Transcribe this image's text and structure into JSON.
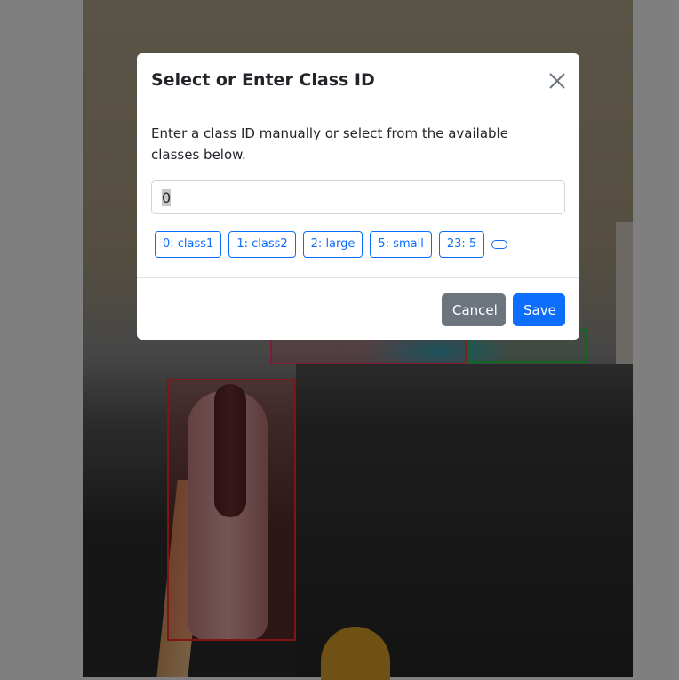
{
  "modal": {
    "title": "Select or Enter Class ID",
    "instructions": "Enter a class ID manually or select from the available classes below.",
    "input": {
      "value": "0",
      "placeholder": ""
    },
    "classes": [
      {
        "label": "0: class1"
      },
      {
        "label": "1: class2"
      },
      {
        "label": "2: large"
      },
      {
        "label": "5: small"
      },
      {
        "label": "23: 5"
      },
      {
        "label": ""
      }
    ],
    "cancel_label": "Cancel",
    "save_label": "Save",
    "close_icon": "close-icon"
  },
  "colors": {
    "primary": "#0d6efd",
    "secondary": "#6c757d",
    "bbox_red": "#ff2a2a",
    "bbox_green": "#22cc44",
    "backdrop": "rgba(0,0,0,0.5)"
  }
}
